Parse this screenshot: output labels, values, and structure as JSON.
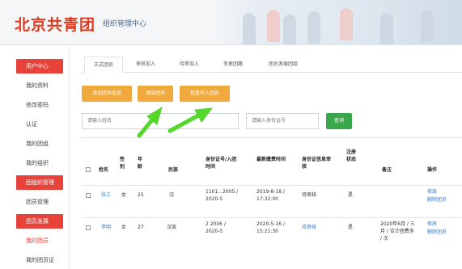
{
  "header": {
    "brand": "北京共青团",
    "subtitle": "组织管理中心"
  },
  "sidebar": {
    "items": [
      {
        "label": "用户中心",
        "type": "section"
      },
      {
        "label": "我的资料",
        "type": "item"
      },
      {
        "label": "修改密码",
        "type": "item"
      },
      {
        "label": "认证",
        "type": "item"
      },
      {
        "label": "我的团组",
        "type": "item"
      },
      {
        "label": "我的组织",
        "type": "item"
      },
      {
        "label": "团组织管理",
        "type": "section"
      },
      {
        "label": "团员管理",
        "type": "item"
      },
      {
        "label": "团员发展",
        "type": "section"
      },
      {
        "label": "我的团员",
        "type": "item"
      },
      {
        "label": "我的团员证",
        "type": "item"
      }
    ]
  },
  "tabs": [
    {
      "label": "正式团员"
    },
    {
      "label": "审核加入"
    },
    {
      "label": "待审加入"
    },
    {
      "label": "变更团籍"
    },
    {
      "label": "团员发展团组"
    }
  ],
  "actions": {
    "btn1": "添加团员信息",
    "btn2": "添加团员",
    "btn3": "批量导入团员",
    "search_label": "查询"
  },
  "search": {
    "placeholder1": "请输入姓名",
    "placeholder2": "请输入身份证号"
  },
  "table": {
    "headers": [
      "",
      "姓名",
      "性别",
      "年龄",
      "民族",
      "身份证号/入团时间",
      "最新缴费时间",
      "身份证信息审核",
      "注册状态",
      "备注",
      "操作"
    ],
    "rows": [
      {
        "name": "张三",
        "gender": "女",
        "age": "25",
        "ethnicity": "汉",
        "id_time": "1101...2005 / 2020-5",
        "pay": "2019-8-18 / 17:32:00",
        "review": "待审核",
        "status": "是",
        "note": "",
        "ops": [
          "修改",
          "删除团员"
        ]
      },
      {
        "name": "李明",
        "gender": "女",
        "age": "27",
        "ethnicity": "汉族",
        "id_time": "2 2006 / 2020-5",
        "pay": "2020-5-16 / 15:21:30",
        "review": "待审核",
        "status": "是",
        "note": "2020年6月 / 三月 / 合计团费多 / 次",
        "ops": [
          "修改",
          "删除团员"
        ]
      }
    ]
  },
  "colors": {
    "brand_red": "#e03a1e",
    "sidebar_section_red": "#e8433a",
    "button_orange": "#f0a93c",
    "button_green": "#3aa84a",
    "arrow_green": "#54d62a",
    "link_blue": "#3a78c4"
  }
}
